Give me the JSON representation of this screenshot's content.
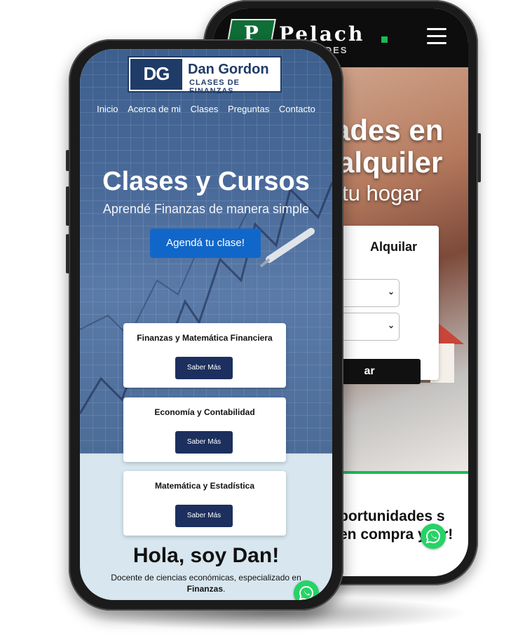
{
  "back_site": {
    "logo_letter": "P",
    "logo_name": "Pelach",
    "logo_sub": "PIEDADES",
    "hero_line1": "ades en",
    "hero_line2": "alquiler",
    "hero_line3": "tu hogar",
    "card_tab": "Alquilar",
    "search_button": "ar",
    "section_text": "portunidades s en compra y ler!",
    "accent_color": "#1db954"
  },
  "front_site": {
    "logo_mark": "DG",
    "logo_name": "Dan Gordon",
    "logo_sub": "CLASES DE FINANZAS",
    "nav": [
      "Inicio",
      "Acerca de mi",
      "Clases",
      "Preguntas",
      "Contacto"
    ],
    "hero_title": "Clases y Cursos",
    "hero_subtitle": "Aprendé Finanzas de manera simple",
    "cta": "Agendá tu clase!",
    "cards": [
      {
        "title": "Finanzas y Matemática Financiera",
        "button": "Saber Más"
      },
      {
        "title": "Economía y Contabilidad",
        "button": "Saber Más"
      },
      {
        "title": "Matemática y Estadística",
        "button": "Saber Más"
      }
    ],
    "hola": "Hola, soy Dan!",
    "desc_prefix": "Docente de ciencias económicas, especializado en",
    "desc_bold": "Finanzas",
    "desc_suffix": ".",
    "brand_color": "#1f3b68",
    "cta_color": "#1167c9"
  },
  "icons": [
    "whatsapp-icon",
    "hamburger-menu-icon",
    "chevron-down-icon"
  ]
}
